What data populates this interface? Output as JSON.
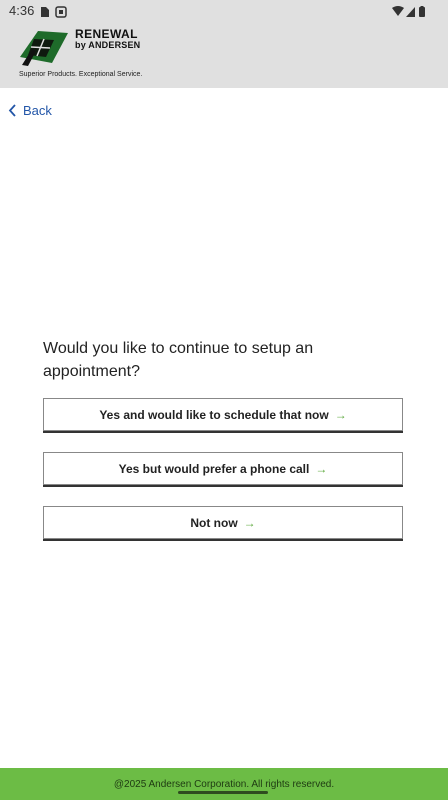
{
  "status_bar": {
    "time": "4:36",
    "left_icons": [
      "sim-card-icon",
      "screen-record-icon"
    ],
    "right_icons": [
      "wifi-icon",
      "cell-signal-icon",
      "battery-icon"
    ]
  },
  "logo": {
    "brand_line1": "RENEWAL",
    "brand_line2": "by ANDERSEN",
    "tagline": "Superior Products. Exceptional Service."
  },
  "nav": {
    "back_label": "Back"
  },
  "main": {
    "question": "Would you like to continue to setup an appointment?",
    "options": [
      {
        "label": "Yes and would like to schedule that now",
        "icon": "arrow-right-icon"
      },
      {
        "label": "Yes but would prefer a phone call",
        "icon": "arrow-right-icon"
      },
      {
        "label": "Not now",
        "icon": "arrow-right-icon"
      }
    ]
  },
  "footer": {
    "text": "@2025 Andersen Corporation. All rights reserved."
  },
  "colors": {
    "accent_green": "#6cbc45",
    "link_blue": "#2356a8",
    "header_gray": "#e0e0e0"
  }
}
